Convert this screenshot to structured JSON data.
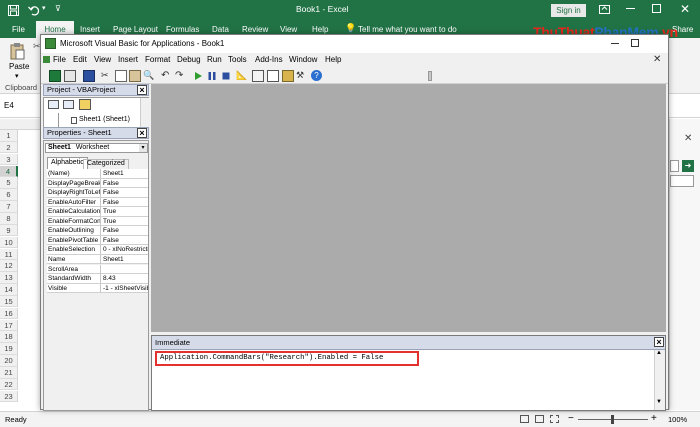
{
  "excel": {
    "title": "Book1  -  Excel",
    "sign_in": "Sign in",
    "share": "Share",
    "tell_me": "Tell me what you want to do",
    "tabs": [
      "File",
      "Home",
      "Insert",
      "Page Layout",
      "Formulas",
      "Data",
      "Review",
      "View",
      "Help"
    ],
    "active_tab": "Home",
    "ribbon": {
      "paste": "Paste",
      "clipboard": "Clipboard"
    },
    "name_box": "E4",
    "rows": [
      "1",
      "2",
      "3",
      "4",
      "5",
      "6",
      "7",
      "8",
      "9",
      "10",
      "11",
      "12",
      "13",
      "14",
      "15",
      "16",
      "17",
      "18",
      "19",
      "20",
      "21",
      "22",
      "23"
    ],
    "selected_row": "4",
    "status": "Ready",
    "zoom": "100%"
  },
  "vbe": {
    "title": "Microsoft Visual Basic for Applications - Book1",
    "menu": [
      "File",
      "Edit",
      "View",
      "Insert",
      "Format",
      "Debug",
      "Run",
      "Tools",
      "Add-Ins",
      "Window",
      "Help"
    ],
    "project_pane": {
      "title": "Project - VBAProject",
      "tree_item": "Sheet1 (Sheet1)"
    },
    "properties_pane": {
      "title": "Properties - Sheet1",
      "object": "Sheet1",
      "object_type": "Worksheet",
      "tabs": [
        "Alphabetic",
        "Categorized"
      ],
      "rows": [
        {
          "name": "(Name)",
          "value": "Sheet1"
        },
        {
          "name": "DisplayPageBreak",
          "value": "False"
        },
        {
          "name": "DisplayRightToLef",
          "value": "False"
        },
        {
          "name": "EnableAutoFilter",
          "value": "False"
        },
        {
          "name": "EnableCalculation",
          "value": "True"
        },
        {
          "name": "EnableFormatCon",
          "value": "True"
        },
        {
          "name": "EnableOutlining",
          "value": "False"
        },
        {
          "name": "EnablePivotTable",
          "value": "False"
        },
        {
          "name": "EnableSelection",
          "value": "0 - xlNoRestrictio"
        },
        {
          "name": "Name",
          "value": "Sheet1"
        },
        {
          "name": "ScrollArea",
          "value": ""
        },
        {
          "name": "StandardWidth",
          "value": "8.43"
        },
        {
          "name": "Visible",
          "value": "-1 - xlSheetVisib"
        }
      ]
    },
    "immediate": {
      "title": "Immediate",
      "code": "Application.CommandBars(\"Research\").Enabled = False"
    }
  },
  "watermark": {
    "text": "ThuThuatPhanMem.vn"
  },
  "colors": {
    "excel_green": "#217346",
    "highlight_box": "#e3312d",
    "code_area": "#ababab"
  }
}
